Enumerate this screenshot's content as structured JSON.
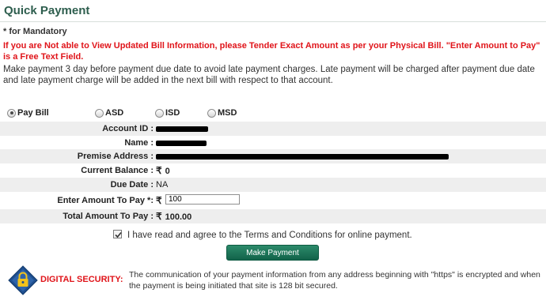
{
  "page": {
    "title": "Quick Payment",
    "mandatory_note": "* for Mandatory",
    "warning": "If you are Not able to View Updated Bill Information, please Tender Exact Amount as per your Physical Bill. \"Enter Amount to Pay\" is a Free Text Field.",
    "info": "Make payment 3 day before payment due date to avoid late payment charges. Late payment will be charged after payment due date and late payment charge will be added in the next bill with respect to that account."
  },
  "payment_type": {
    "options": [
      {
        "label": "Pay Bill",
        "checked": true
      },
      {
        "label": "ASD",
        "checked": false
      },
      {
        "label": "ISD",
        "checked": false
      },
      {
        "label": "MSD",
        "checked": false
      }
    ]
  },
  "form": {
    "account_id_label": "Account ID :",
    "name_label": "Name :",
    "premise_label": "Premise Address :",
    "balance_label": "Current Balance :",
    "balance_value": "0",
    "due_date_label": "Due Date :",
    "due_date_value": "NA",
    "amount_label": "Enter Amount To Pay *:",
    "amount_value": "100",
    "total_label": "Total Amount To Pay :",
    "total_value": "100.00",
    "rupee_symbol": "₹",
    "terms_text": "I have read and agree to the Terms and Conditions for online payment.",
    "terms_checked": true
  },
  "actions": {
    "make_payment_label": "Make Payment"
  },
  "security": {
    "label": "DIGITAL SECURITY:",
    "text": "The communication of your payment information from any address beginning with \"https\" is encrypted and when the payment is being initiated that site is 128 bit secured.",
    "icon": "lock-shield-icon"
  },
  "colors": {
    "title": "#2e5e4e",
    "warning": "#e0141a",
    "button": "#1a6f52",
    "row_shade": "#eeeeee"
  }
}
